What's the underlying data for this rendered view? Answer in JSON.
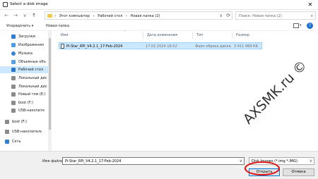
{
  "window": {
    "title": "Select a disk image",
    "close_glyph": "✕"
  },
  "nav": {
    "back_glyph": "←",
    "forward_glyph": "→",
    "history_glyph": "∨",
    "up_glyph": "↑",
    "breadcrumbs": [
      "›",
      "Этот компьютер",
      "›",
      "Рабочий стол",
      "›",
      "Новая папка (2)"
    ],
    "breadcrumb_dropdown": "∨",
    "refresh_glyph": "⟳",
    "search_placeholder": "Поиск: Новая папка (2)",
    "search_glyph": "⌕"
  },
  "toolbar": {
    "organize_label": "Упорядочить ▾",
    "new_folder_label": "Новая папка",
    "view_dropdown": "▾",
    "help_label": "?"
  },
  "sidebar": {
    "items": [
      {
        "label": "Загрузки",
        "icon": "download-icon",
        "color": "#2d7fd1"
      },
      {
        "label": "Изображения",
        "icon": "pictures-icon",
        "color": "#4d9be0"
      },
      {
        "label": "Музыка",
        "icon": "music-icon",
        "color": "#3a84d6"
      },
      {
        "label": "Объемные объ",
        "icon": "3d-objects-icon",
        "color": "#5aa0e0"
      },
      {
        "label": "Рабочий стол",
        "icon": "desktop-icon",
        "color": "#2c78c8"
      },
      {
        "label": "Локальный дис",
        "icon": "drive-icon",
        "color": "#8a8a8a"
      },
      {
        "label": "Локальный дис",
        "icon": "drive-icon",
        "color": "#8a8a8a"
      },
      {
        "label": "Новый том (E:)",
        "icon": "drive-icon",
        "color": "#8a8a8a"
      },
      {
        "label": "boot (F:)",
        "icon": "drive-icon",
        "color": "#8a8a8a"
      },
      {
        "label": "USB-накопите",
        "icon": "usb-drive-icon",
        "color": "#8a8a8a"
      },
      {
        "label": "boot (F:)",
        "icon": "drive-icon",
        "color": "#8a8a8a"
      },
      {
        "label": "USB-накопитель",
        "icon": "usb-drive-icon",
        "color": "#8a8a8a"
      },
      {
        "label": "Сеть",
        "icon": "network-icon",
        "color": "#2d7fd1"
      }
    ]
  },
  "filelist": {
    "columns": [
      "Имя",
      "Дата изменения",
      "Тип",
      "Размер"
    ],
    "sort_glyph": "^",
    "rows": [
      {
        "name": "Pi-Star_RPi_V4.2.1_17-Feb-2024",
        "date": "17.02.2024 19:52",
        "type": "Файл образа диска",
        "size": "3 411 969 КБ"
      }
    ]
  },
  "footer": {
    "filename_label": "Имя файла:",
    "filename_value": "Pi-Star_RPi_V4.2.1_17-Feb-2024",
    "filter_value": "Disk Images (*.img *.IMG)",
    "dropdown_glyph": "∨",
    "open_label": "Открыть",
    "cancel_label": "Отмена"
  },
  "watermark": "AXSMK.ru ©",
  "colors": {
    "selection": "#cce8ff",
    "accent": "#0078d7",
    "annotation_ring": "#e01010"
  }
}
